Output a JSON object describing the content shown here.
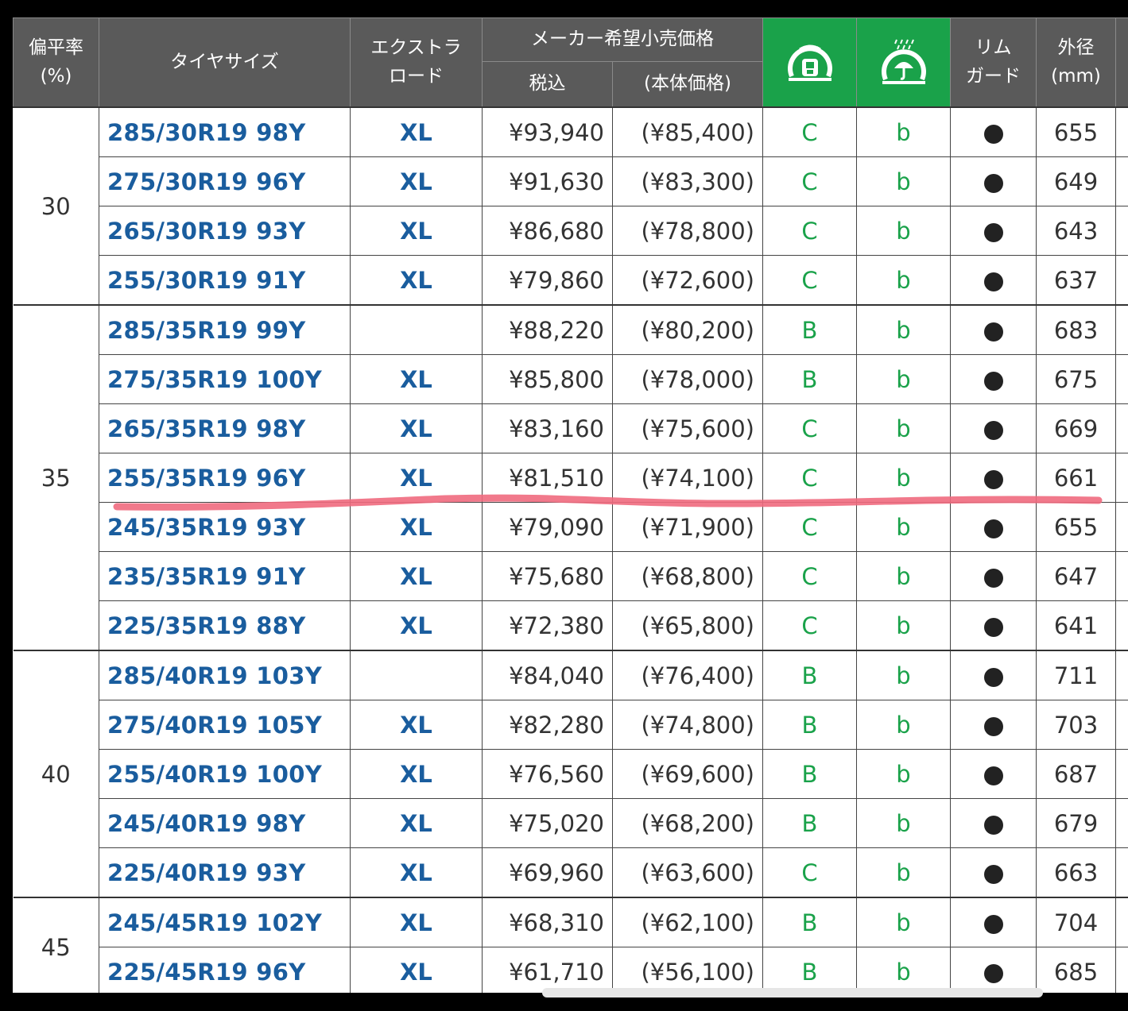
{
  "header": {
    "ratio": [
      "偏平率",
      "(%)"
    ],
    "size": "タイヤサイズ",
    "xl": [
      "エクストラ",
      "ロード"
    ],
    "price_group": "メーカー希望小売価格",
    "price_tax": "税込",
    "price_body": "(本体価格)",
    "rolling_icon": "rolling-resistance-icon",
    "wet_icon": "wet-grip-icon",
    "rim": [
      "リム",
      "ガード"
    ],
    "diameter": [
      "外径",
      "(mm)"
    ]
  },
  "colors": {
    "header_bg": "#5a5a5a",
    "icon_header_bg": "#1aa24a",
    "size_text": "#1a5d9e",
    "grade_text": "#1aa24a",
    "annotation_line": "#f06a7e"
  },
  "groups": [
    {
      "ratio": "30",
      "rows": [
        {
          "size": "285/30R19 98Y",
          "xl": "XL",
          "price": "¥93,940",
          "body": "(¥85,400)",
          "rolling": "C",
          "wet": "b",
          "rim": "●",
          "diameter": "655"
        },
        {
          "size": "275/30R19 96Y",
          "xl": "XL",
          "price": "¥91,630",
          "body": "(¥83,300)",
          "rolling": "C",
          "wet": "b",
          "rim": "●",
          "diameter": "649"
        },
        {
          "size": "265/30R19 93Y",
          "xl": "XL",
          "price": "¥86,680",
          "body": "(¥78,800)",
          "rolling": "C",
          "wet": "b",
          "rim": "●",
          "diameter": "643"
        },
        {
          "size": "255/30R19 91Y",
          "xl": "XL",
          "price": "¥79,860",
          "body": "(¥72,600)",
          "rolling": "C",
          "wet": "b",
          "rim": "●",
          "diameter": "637"
        }
      ]
    },
    {
      "ratio": "35",
      "rows": [
        {
          "size": "285/35R19 99Y",
          "xl": "",
          "price": "¥88,220",
          "body": "(¥80,200)",
          "rolling": "B",
          "wet": "b",
          "rim": "●",
          "diameter": "683"
        },
        {
          "size": "275/35R19 100Y",
          "xl": "XL",
          "price": "¥85,800",
          "body": "(¥78,000)",
          "rolling": "B",
          "wet": "b",
          "rim": "●",
          "diameter": "675"
        },
        {
          "size": "265/35R19 98Y",
          "xl": "XL",
          "price": "¥83,160",
          "body": "(¥75,600)",
          "rolling": "C",
          "wet": "b",
          "rim": "●",
          "diameter": "669"
        },
        {
          "size": "255/35R19 96Y",
          "xl": "XL",
          "price": "¥81,510",
          "body": "(¥74,100)",
          "rolling": "C",
          "wet": "b",
          "rim": "●",
          "diameter": "661"
        },
        {
          "size": "245/35R19 93Y",
          "xl": "XL",
          "price": "¥79,090",
          "body": "(¥71,900)",
          "rolling": "C",
          "wet": "b",
          "rim": "●",
          "diameter": "655"
        },
        {
          "size": "235/35R19 91Y",
          "xl": "XL",
          "price": "¥75,680",
          "body": "(¥68,800)",
          "rolling": "C",
          "wet": "b",
          "rim": "●",
          "diameter": "647"
        },
        {
          "size": "225/35R19 88Y",
          "xl": "XL",
          "price": "¥72,380",
          "body": "(¥65,800)",
          "rolling": "C",
          "wet": "b",
          "rim": "●",
          "diameter": "641"
        }
      ]
    },
    {
      "ratio": "40",
      "rows": [
        {
          "size": "285/40R19 103Y",
          "xl": "",
          "price": "¥84,040",
          "body": "(¥76,400)",
          "rolling": "B",
          "wet": "b",
          "rim": "●",
          "diameter": "711"
        },
        {
          "size": "275/40R19 105Y",
          "xl": "XL",
          "price": "¥82,280",
          "body": "(¥74,800)",
          "rolling": "B",
          "wet": "b",
          "rim": "●",
          "diameter": "703"
        },
        {
          "size": "255/40R19 100Y",
          "xl": "XL",
          "price": "¥76,560",
          "body": "(¥69,600)",
          "rolling": "B",
          "wet": "b",
          "rim": "●",
          "diameter": "687"
        },
        {
          "size": "245/40R19 98Y",
          "xl": "XL",
          "price": "¥75,020",
          "body": "(¥68,200)",
          "rolling": "B",
          "wet": "b",
          "rim": "●",
          "diameter": "679"
        },
        {
          "size": "225/40R19 93Y",
          "xl": "XL",
          "price": "¥69,960",
          "body": "(¥63,600)",
          "rolling": "C",
          "wet": "b",
          "rim": "●",
          "diameter": "663"
        }
      ]
    },
    {
      "ratio": "45",
      "rows": [
        {
          "size": "245/45R19 102Y",
          "xl": "XL",
          "price": "¥68,310",
          "body": "(¥62,100)",
          "rolling": "B",
          "wet": "b",
          "rim": "●",
          "diameter": "704"
        },
        {
          "size": "225/45R19 96Y",
          "xl": "XL",
          "price": "¥61,710",
          "body": "(¥56,100)",
          "rolling": "B",
          "wet": "b",
          "rim": "●",
          "diameter": "685"
        }
      ]
    }
  ]
}
